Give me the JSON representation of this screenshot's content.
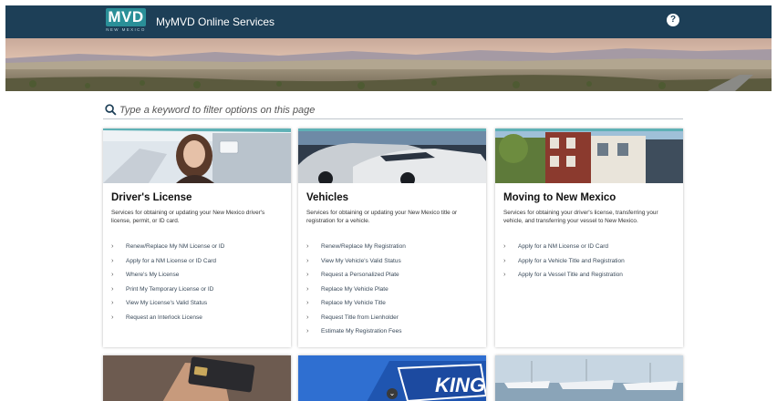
{
  "header": {
    "logo_text": "MVD",
    "logo_subtext": "NEW MEXICO",
    "app_title": "MyMVD Online Services",
    "help_label": "?"
  },
  "search": {
    "placeholder": "Type a keyword to filter options on this page"
  },
  "cards": [
    {
      "title": "Driver's License",
      "description": "Services for obtaining or updating your New Mexico driver's license, permit, or ID card.",
      "links": [
        "Renew/Replace My NM License or ID",
        "Apply for a NM License or ID Card",
        "Where's My License",
        "Print My Temporary License or ID",
        "View My License's Valid Status",
        "Request an Interlock License"
      ]
    },
    {
      "title": "Vehicles",
      "description": "Services for obtaining or updating your New Mexico title or registration for a vehicle.",
      "links": [
        "Renew/Replace My Registration",
        "View My Vehicle's Valid Status",
        "Request a Personalized Plate",
        "Replace My Vehicle Plate",
        "Replace My Vehicle Title",
        "Request Title from Lienholder",
        "Estimate My Registration Fees"
      ]
    },
    {
      "title": "Moving to New Mexico",
      "description": "Services for obtaining your driver's license, transferring your vehicle, and transferring your vessel to New Mexico.",
      "links": [
        "Apply for a NM License or ID Card",
        "Apply for a Vehicle Title and Registration",
        "Apply for a Vessel Title and Registration"
      ]
    }
  ],
  "bottom_cards": [
    {
      "image": "credit-card-payment-photo"
    },
    {
      "image": "parking-sign-photo",
      "visible_text": "KING"
    },
    {
      "image": "marina-boats-photo"
    }
  ],
  "icons": {
    "search": "magnifier-icon",
    "help": "question-circle-icon",
    "link": "chevron-right-icon",
    "scroll": "chevron-down-icon"
  },
  "colors": {
    "header_bg": "#1d3f57",
    "logo_bg": "#2a8f98",
    "link_text": "#3a4a5a"
  }
}
